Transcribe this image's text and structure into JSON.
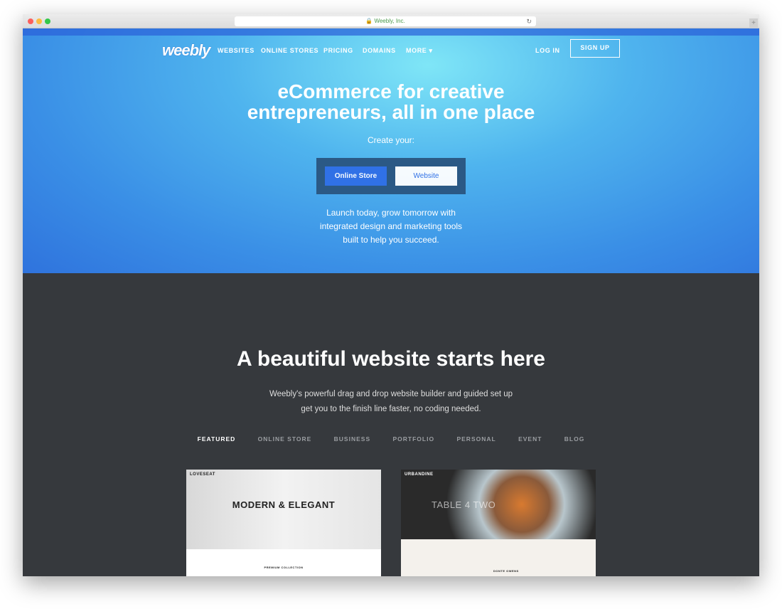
{
  "browser": {
    "url": "Weebly, Inc."
  },
  "nav": {
    "logo": "weebly",
    "items": [
      "WEBSITES",
      "ONLINE STORES",
      "PRICING",
      "DOMAINS",
      "MORE ▾"
    ],
    "login": "LOG IN",
    "signup": "SIGN UP"
  },
  "hero": {
    "title_line1": "eCommerce for creative",
    "title_line2": "entrepreneurs, all in one place",
    "create": "Create your:",
    "btn_store": "Online Store",
    "btn_website": "Website",
    "tagline1": "Launch today, grow tomorrow with",
    "tagline2": "integrated design and marketing tools",
    "tagline3": "built to help you succeed."
  },
  "section": {
    "title": "A beautiful website starts here",
    "sub1": "Weebly's powerful drag and drop website builder and guided set up",
    "sub2": "get you to the finish line faster, no coding needed.",
    "tabs": [
      "FEATURED",
      "ONLINE STORE",
      "BUSINESS",
      "PORTFOLIO",
      "PERSONAL",
      "EVENT",
      "BLOG"
    ]
  },
  "themes": [
    {
      "name": "LOVESEAT",
      "headline": "MODERN & ELEGANT",
      "caption": "PREMIUM COLLECTION"
    },
    {
      "name": "URBANDINE",
      "headline": "TABLE 4 TWO",
      "caption": "DONTE OWENS"
    }
  ],
  "colors": {
    "accent": "#2f6ee6",
    "dark": "#36393d"
  }
}
